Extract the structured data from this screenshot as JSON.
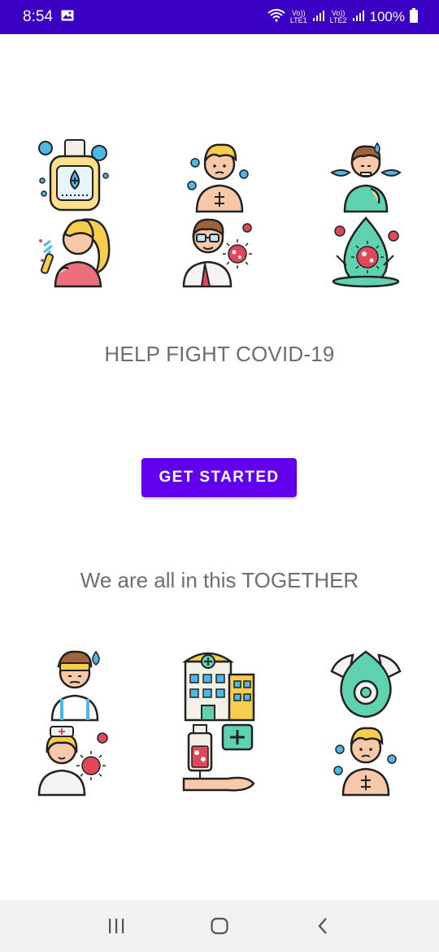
{
  "status_bar": {
    "time": "8:54",
    "battery": "100%",
    "sim1_top": "Vo))",
    "sim1_bottom": "LTE1",
    "sim2_top": "Vo))",
    "sim2_bottom": "LTE2",
    "icons": [
      "gallery-icon",
      "wifi-icon",
      "signal-icon",
      "battery-icon"
    ]
  },
  "main": {
    "headline": "HELP FIGHT COVID-19",
    "cta_label": "GET STARTED",
    "tagline": "We are all in this TOGETHER",
    "top_illustrations": [
      "hand-sanitizer",
      "sick-child",
      "coughing-man",
      "sneezing-woman",
      "doctor-with-virus",
      "virus-droplet"
    ],
    "bottom_illustrations": [
      "fever-patient",
      "hospital",
      "face-mask",
      "nurse-with-virus",
      "blood-transfusion",
      "sick-child"
    ]
  },
  "colors": {
    "status_bar": "#3a00c4",
    "primary_button": "#6200ee",
    "text_gray": "#6e6e6e",
    "nav_bar": "#f2f2f2"
  },
  "nav_bar": {
    "icons": [
      "recents-icon",
      "home-icon",
      "back-icon"
    ]
  }
}
